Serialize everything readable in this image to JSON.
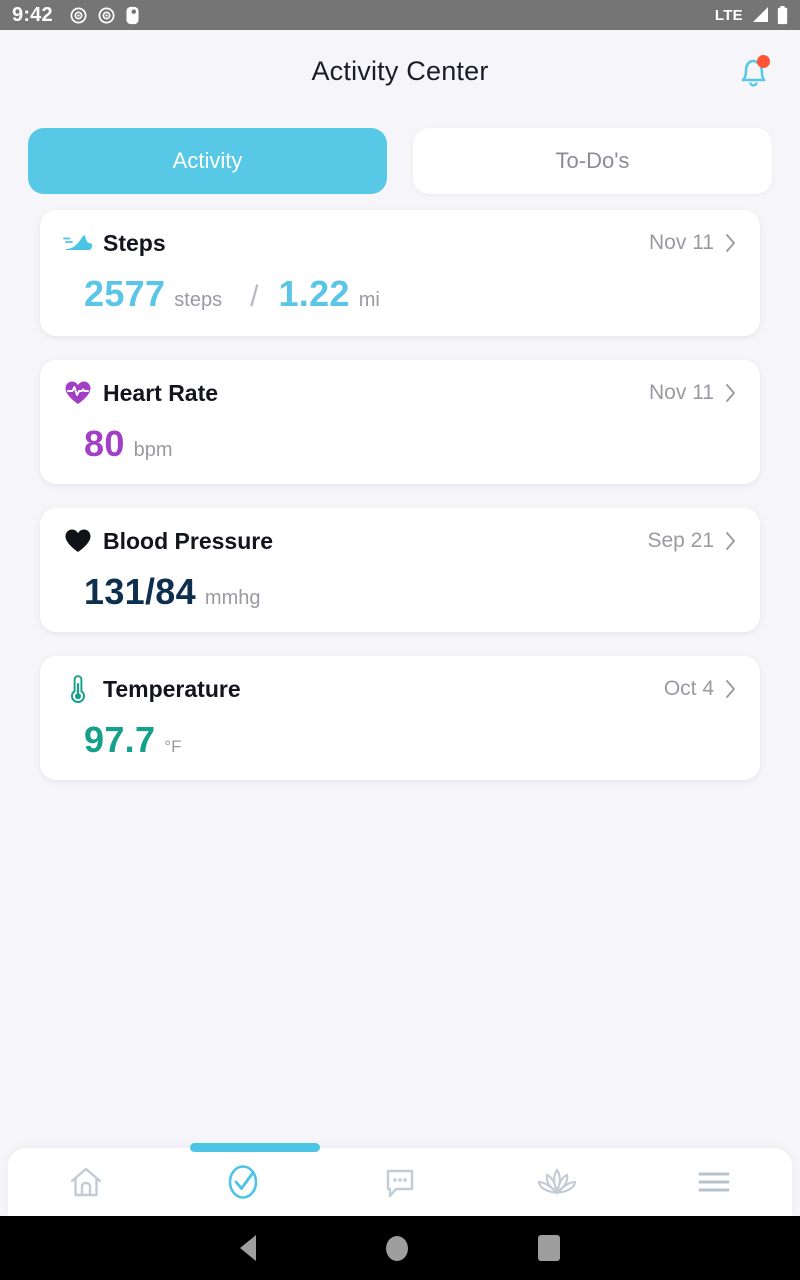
{
  "status_bar": {
    "time": "9:42",
    "network": "LTE",
    "icons": [
      "alarm-icon",
      "alarm-icon",
      "battery-saver-icon",
      "signal-icon",
      "battery-icon"
    ]
  },
  "header": {
    "title": "Activity Center",
    "bell_icon": "notification-bell-icon",
    "has_badge": true,
    "badge_color": "#ff5436",
    "bell_color": "#57c9e6"
  },
  "tabs": [
    {
      "label": "Activity",
      "active": true
    },
    {
      "label": "To-Do's",
      "active": false
    }
  ],
  "cards": [
    {
      "icon": "sneaker-icon",
      "title": "Steps",
      "date": "Nov 11",
      "value": "2577",
      "unit": "steps",
      "divider": "/",
      "value2": "1.22",
      "unit2": "mi",
      "color": "#5bc5e8"
    },
    {
      "icon": "heart-pulse-icon",
      "title": "Heart Rate",
      "date": "Nov 11",
      "value": "80",
      "unit": "bpm",
      "color": "#a23fc4"
    },
    {
      "icon": "heart-filled-icon",
      "title": "Blood Pressure",
      "date": "Sep 21",
      "value": "131/84",
      "unit": "mmhg",
      "color": "#0e2f4e"
    },
    {
      "icon": "thermometer-icon",
      "title": "Temperature",
      "date": "Oct 4",
      "value": "97.7",
      "unit": "°F",
      "color": "#14a08a"
    }
  ],
  "bottom_nav": {
    "items": [
      {
        "icon": "home-icon",
        "active": false
      },
      {
        "icon": "check-circle-icon",
        "active": true
      },
      {
        "icon": "chat-bubble-icon",
        "active": false
      },
      {
        "icon": "lotus-icon",
        "active": false
      },
      {
        "icon": "menu-icon",
        "active": false
      }
    ],
    "active_color": "#4cc4e4",
    "inactive_color": "#c3cbd4"
  },
  "android_nav": {
    "back": "back-triangle-icon",
    "home": "home-circle-icon",
    "recents": "recents-square-icon"
  }
}
